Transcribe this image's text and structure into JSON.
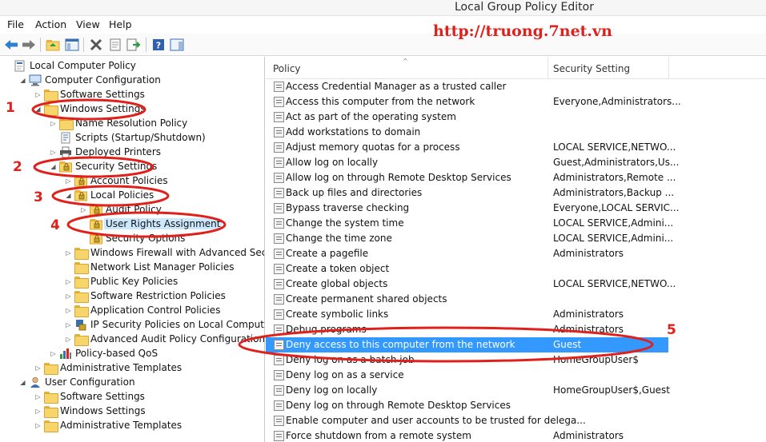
{
  "window": {
    "title": "Local Group Policy Editor"
  },
  "menu": [
    {
      "label": "File"
    },
    {
      "label": "Action"
    },
    {
      "label": "View"
    },
    {
      "label": "Help"
    }
  ],
  "toolbar": {
    "icons": [
      "back-icon",
      "forward-icon",
      "up-folder-icon",
      "show-hide-tree-icon",
      "delete-icon",
      "properties-icon",
      "export-list-icon",
      "help-icon",
      "show-hide-action-pane-icon"
    ]
  },
  "watermark": "http://truong.7net.vn",
  "tree": [
    {
      "label": "Local Computer Policy",
      "icon": "local-policy-icon",
      "twisty": ""
    },
    {
      "label": "Computer Configuration",
      "icon": "computer-icon",
      "twisty": "◢"
    },
    {
      "label": "Software Settings",
      "icon": "folder-icon",
      "twisty": "▷"
    },
    {
      "label": "Windows Settings",
      "icon": "folder-icon",
      "twisty": "◢"
    },
    {
      "label": "Name Resolution Policy",
      "icon": "folder-icon",
      "twisty": "▷"
    },
    {
      "label": "Scripts (Startup/Shutdown)",
      "icon": "script-icon",
      "twisty": ""
    },
    {
      "label": "Deployed Printers",
      "icon": "printer-icon",
      "twisty": "▷"
    },
    {
      "label": "Security Settings",
      "icon": "security-icon",
      "twisty": "◢"
    },
    {
      "label": "Account Policies",
      "icon": "security-folder-icon",
      "twisty": "▷"
    },
    {
      "label": "Local Policies",
      "icon": "security-folder-icon",
      "twisty": "◢"
    },
    {
      "label": "Audit Policy",
      "icon": "security-folder-icon",
      "twisty": "▷"
    },
    {
      "label": "User Rights Assignment",
      "icon": "security-folder-icon",
      "twisty": ""
    },
    {
      "label": "Security Options",
      "icon": "security-folder-icon",
      "twisty": ""
    },
    {
      "label": "Windows Firewall with Advanced Security",
      "icon": "folder-icon",
      "twisty": "▷"
    },
    {
      "label": "Network List Manager Policies",
      "icon": "folder-icon",
      "twisty": ""
    },
    {
      "label": "Public Key Policies",
      "icon": "folder-icon",
      "twisty": "▷"
    },
    {
      "label": "Software Restriction Policies",
      "icon": "folder-icon",
      "twisty": "▷"
    },
    {
      "label": "Application Control Policies",
      "icon": "folder-icon",
      "twisty": "▷"
    },
    {
      "label": "IP Security Policies on Local Computer",
      "icon": "ip-security-icon",
      "twisty": "▷"
    },
    {
      "label": "Advanced Audit Policy Configuration",
      "icon": "folder-icon",
      "twisty": "▷"
    },
    {
      "label": "Policy-based QoS",
      "icon": "qos-chart-icon",
      "twisty": "▷"
    },
    {
      "label": "Administrative Templates",
      "icon": "folder-icon",
      "twisty": "▷"
    },
    {
      "label": "User Configuration",
      "icon": "user-icon",
      "twisty": "◢"
    },
    {
      "label": "Software Settings",
      "icon": "folder-icon",
      "twisty": "▷"
    },
    {
      "label": "Windows Settings",
      "icon": "folder-icon",
      "twisty": "▷"
    },
    {
      "label": "Administrative Templates",
      "icon": "folder-icon",
      "twisty": "▷"
    }
  ],
  "list": {
    "columns": {
      "policy": "Policy",
      "setting": "Security Setting"
    },
    "rows": [
      {
        "policy": "Access Credential Manager as a trusted caller",
        "setting": ""
      },
      {
        "policy": "Access this computer from the network",
        "setting": "Everyone,Administrators..."
      },
      {
        "policy": "Act as part of the operating system",
        "setting": ""
      },
      {
        "policy": "Add workstations to domain",
        "setting": ""
      },
      {
        "policy": "Adjust memory quotas for a process",
        "setting": "LOCAL SERVICE,NETWO..."
      },
      {
        "policy": "Allow log on locally",
        "setting": "Guest,Administrators,Us..."
      },
      {
        "policy": "Allow log on through Remote Desktop Services",
        "setting": "Administrators,Remote ..."
      },
      {
        "policy": "Back up files and directories",
        "setting": "Administrators,Backup ..."
      },
      {
        "policy": "Bypass traverse checking",
        "setting": "Everyone,LOCAL SERVIC..."
      },
      {
        "policy": "Change the system time",
        "setting": "LOCAL SERVICE,Admini..."
      },
      {
        "policy": "Change the time zone",
        "setting": "LOCAL SERVICE,Admini..."
      },
      {
        "policy": "Create a pagefile",
        "setting": "Administrators"
      },
      {
        "policy": "Create a token object",
        "setting": ""
      },
      {
        "policy": "Create global objects",
        "setting": "LOCAL SERVICE,NETWO..."
      },
      {
        "policy": "Create permanent shared objects",
        "setting": ""
      },
      {
        "policy": "Create symbolic links",
        "setting": "Administrators"
      },
      {
        "policy": "Debug programs",
        "setting": "Administrators"
      },
      {
        "policy": "Deny access to this computer from the network",
        "setting": "Guest"
      },
      {
        "policy": "Deny log on as a batch job",
        "setting": "HomeGroupUser$"
      },
      {
        "policy": "Deny log on as a service",
        "setting": ""
      },
      {
        "policy": "Deny log on locally",
        "setting": "HomeGroupUser$,Guest"
      },
      {
        "policy": "Deny log on through Remote Desktop Services",
        "setting": ""
      },
      {
        "policy": "Enable computer and user accounts to be trusted for delega...",
        "setting": ""
      },
      {
        "policy": "Force shutdown from a remote system",
        "setting": "Administrators"
      }
    ]
  },
  "selection": {
    "tree_label": "User Rights Assignment",
    "list_policy": "Deny access to this computer from the network"
  },
  "annotations": [
    "1",
    "2",
    "3",
    "4",
    "5"
  ],
  "colors": {
    "annotation_red": "#e0201a",
    "selection_blue": "#3399ff",
    "folder_yellow": "#f8d56b"
  }
}
